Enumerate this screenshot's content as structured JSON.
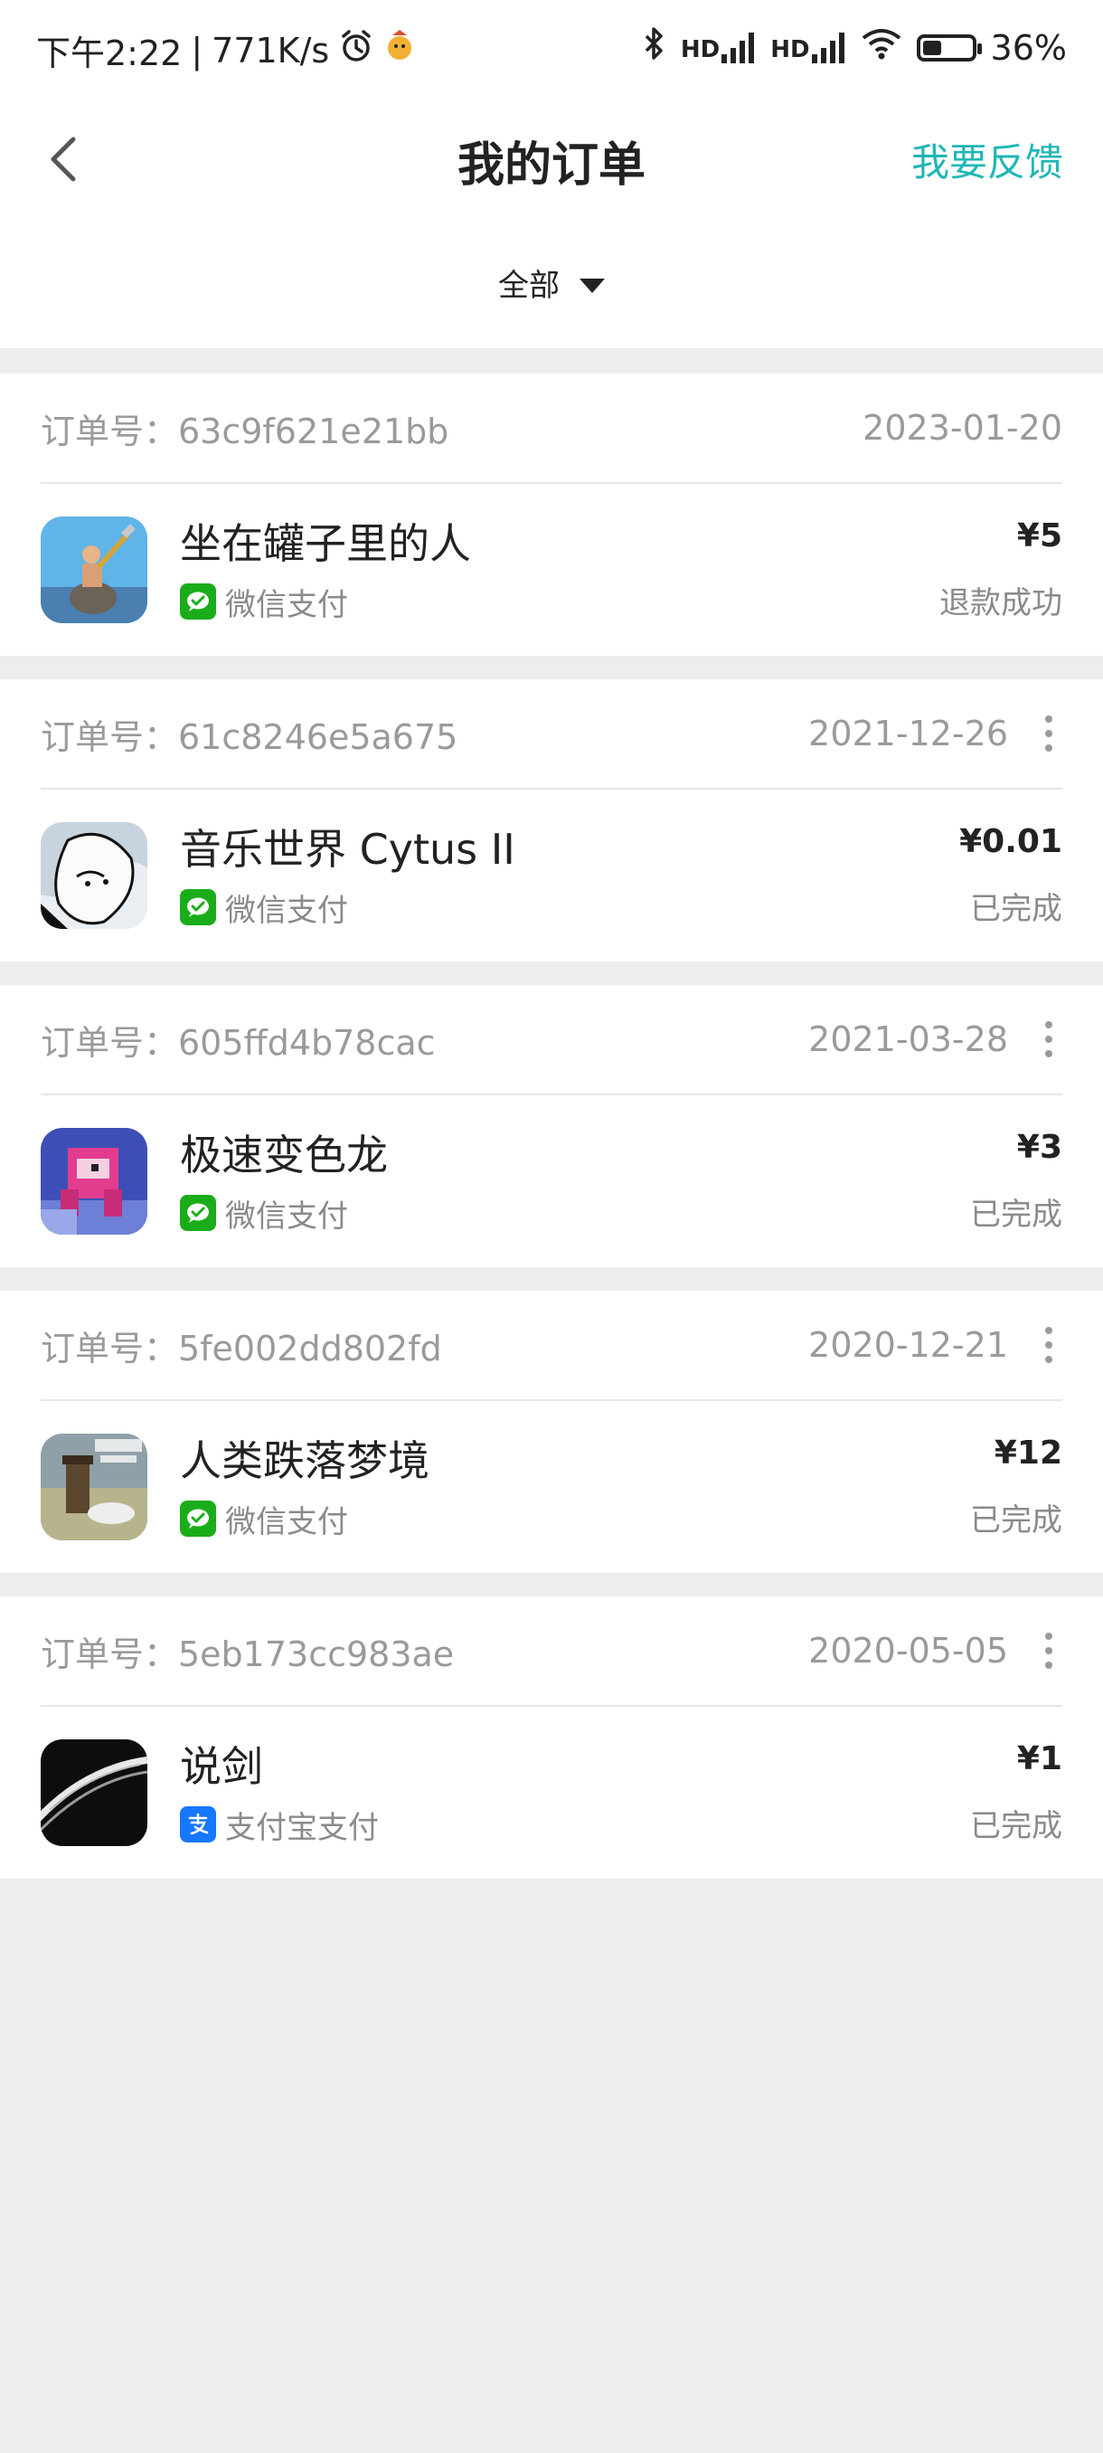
{
  "status_bar": {
    "time": "下午2:22",
    "net_speed": "771K/s",
    "signal_hd_1": "HD",
    "signal_hd_2": "HD",
    "battery_percent": "36%"
  },
  "nav": {
    "title": "我的订单",
    "feedback_label": "我要反馈"
  },
  "filter": {
    "label": "全部"
  },
  "orders": [
    {
      "order_no": "订单号：63c9f621e21bb",
      "date": "2023-01-20",
      "name": "坐在罐子里的人",
      "payment": "微信支付",
      "payment_type": "wechat",
      "price": "¥5",
      "status": "退款成功",
      "has_more": false
    },
    {
      "order_no": "订单号：61c8246e5a675",
      "date": "2021-12-26",
      "name": "音乐世界 Cytus II",
      "payment": "微信支付",
      "payment_type": "wechat",
      "price": "¥0.01",
      "status": "已完成",
      "has_more": true
    },
    {
      "order_no": "订单号：605ffd4b78cac",
      "date": "2021-03-28",
      "name": "极速变色龙",
      "payment": "微信支付",
      "payment_type": "wechat",
      "price": "¥3",
      "status": "已完成",
      "has_more": true
    },
    {
      "order_no": "订单号：5fe002dd802fd",
      "date": "2020-12-21",
      "name": "人类跌落梦境",
      "payment": "微信支付",
      "payment_type": "wechat",
      "price": "¥12",
      "status": "已完成",
      "has_more": true
    },
    {
      "order_no": "订单号：5eb173cc983ae",
      "date": "2020-05-05",
      "name": "说剑",
      "payment": "支付宝支付",
      "payment_type": "alipay",
      "price": "¥1",
      "status": "已完成",
      "has_more": true
    }
  ],
  "colors": {
    "accent": "#20b6b6",
    "wechat_green": "#1aad19",
    "alipay_blue": "#1677ff",
    "page_bg": "#ededed"
  }
}
